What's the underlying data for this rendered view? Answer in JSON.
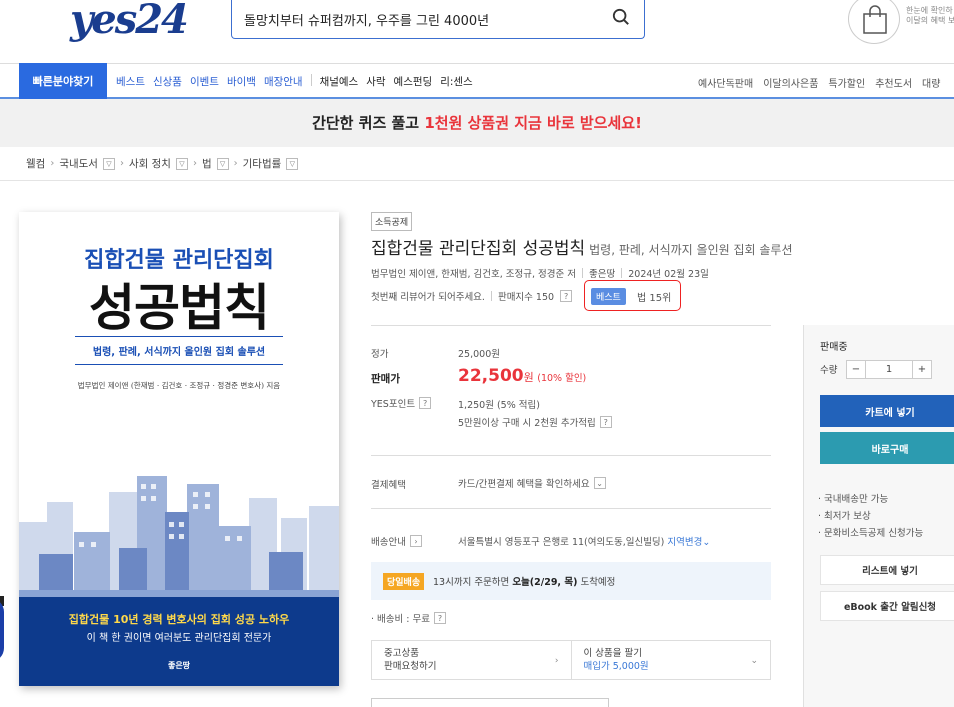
{
  "header": {
    "logo": "yes24",
    "search_value": "돌망치부터 슈퍼컴까지, 우주를 그린 4000년",
    "promo_mini": [
      "한눈에 확인하",
      "이달의 혜택 보"
    ]
  },
  "nav": {
    "main_button": "빠른분야찾기",
    "links_blue": [
      "베스트",
      "신상품",
      "이벤트",
      "바이백",
      "매장안내"
    ],
    "links_dark": [
      "채널예스",
      "사락",
      "예스펀딩",
      "리:센스"
    ],
    "links_right": [
      "예사단독판매",
      "이달의사은품",
      "특가할인",
      "추천도서",
      "대량"
    ]
  },
  "banner": {
    "prefix": "간단한 퀴즈 풀고 ",
    "highlight": "1천원 상품권 지금 바로 받으세요!"
  },
  "breadcrumb": [
    "웰컴",
    "국내도서",
    "사회 정치",
    "법",
    "기타법률"
  ],
  "cover": {
    "title_top": "집합건물 관리단집회",
    "title_main": "성공법칙",
    "subtitle": "법령, 판례, 서식까지 올인원 집회 솔루션",
    "authors": "법무법인 제이앤 (한재범 · 김건호 · 조정규 · 정경준 변호사) 지음",
    "band_line1": "집합건물 10년 경력 변호사의 집회 성공 노하우",
    "band_line2": "이 책 한 권이면 여러분도 관리단집회 전문가",
    "publisher": "좋은땅"
  },
  "product": {
    "tag": "소득공제",
    "title": "집합건물 관리단집회 성공법칙",
    "subtitle": "법령, 판례, 서식까지 올인원 집회 솔루션",
    "authors": "법무법인 제이앤, 한재범, 김건호, 조정규, 정경준 저",
    "publisher": "좋은땅",
    "date": "2024년 02월 23일",
    "review_prompt": "첫번째 리뷰어가 되어주세요.",
    "sales_index": "판매지수 150",
    "qmark": "?",
    "best_badge": "베스트",
    "best_rank": "법 15위"
  },
  "price": {
    "list_label": "정가",
    "list_value": "25,000원",
    "sale_label": "판매가",
    "sale_value": "22,500",
    "sale_unit": "원",
    "discount": "(10% 할인)",
    "points_label": "YES포인트",
    "points_value": "1,250원 (5% 적립)",
    "points_extra": "5만원이상 구매 시 2천원 추가적립"
  },
  "payment": {
    "label": "결제혜택",
    "value": "카드/간편결제 혜택을 확인하세요"
  },
  "delivery": {
    "label": "배송안내",
    "address": "서울특별시 영등포구 은행로 11(여의도동,일신빌딩)",
    "change": "지역변경",
    "badge": "당일배송",
    "text_pre": "13시까지 주문하면 ",
    "text_bold": "오늘(2/29, 목)",
    "text_post": " 도착예정",
    "fee": "· 배송비 : 무료"
  },
  "used": {
    "left_line1": "중고상품",
    "left_line2": "판매요청하기",
    "right_line1": "이 상품을 팔기",
    "right_line2": "매입가 5,000원"
  },
  "side_panel": {
    "title": "판매중",
    "qty_label": "수량",
    "qty_value": "1",
    "minus": "−",
    "plus": "+",
    "cart_button": "카트에 넣기",
    "buy_button": "바로구매",
    "features": [
      "· 국내배송만 가능",
      "· 최저가 보상",
      "· 문화비소득공제 신청가능"
    ],
    "wishlist_button": "리스트에 넣기",
    "ebook_button": "eBook 출간 알림신청"
  }
}
